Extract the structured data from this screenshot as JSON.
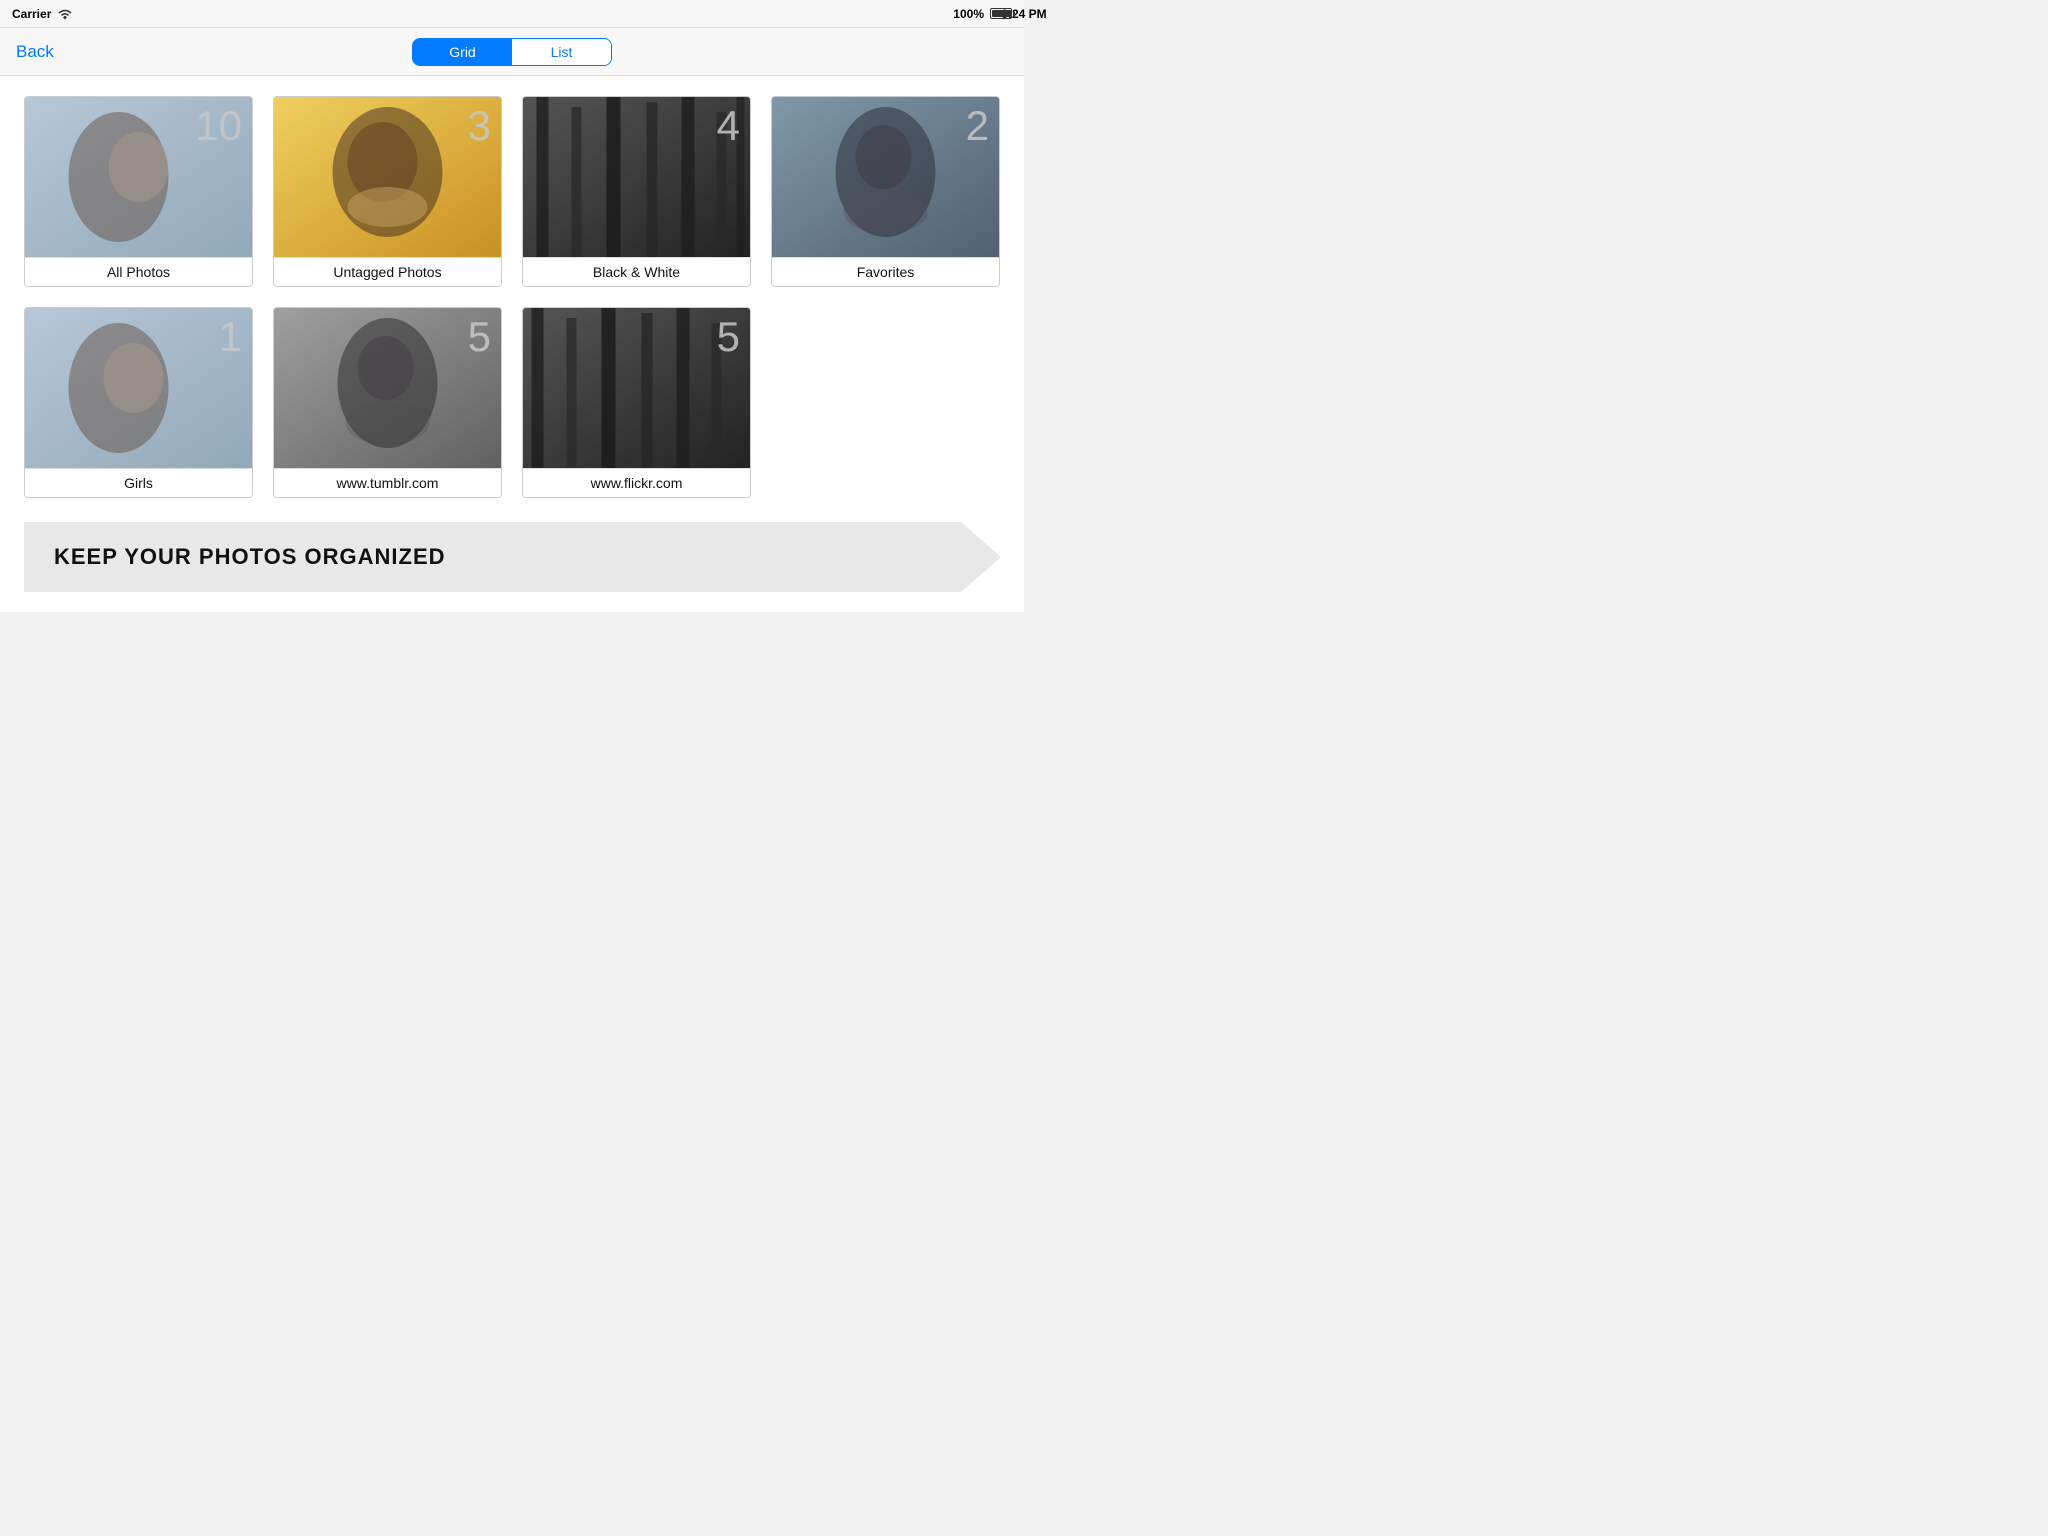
{
  "statusBar": {
    "carrier": "Carrier",
    "time": "9:24 PM",
    "battery": "100%"
  },
  "navBar": {
    "backLabel": "Back",
    "segmented": {
      "grid": "Grid",
      "list": "List",
      "active": "grid"
    }
  },
  "albums": [
    {
      "id": "all-photos",
      "label": "All Photos",
      "count": "10",
      "thumbClass": "thumb-allphotos"
    },
    {
      "id": "untagged-photos",
      "label": "Untagged Photos",
      "count": "3",
      "thumbClass": "thumb-untagged"
    },
    {
      "id": "black-white",
      "label": "Black & White",
      "count": "4",
      "thumbClass": "thumb-blackwhite"
    },
    {
      "id": "favorites",
      "label": "Favorites",
      "count": "2",
      "thumbClass": "thumb-favorites"
    },
    {
      "id": "girls",
      "label": "Girls",
      "count": "1",
      "thumbClass": "thumb-girls"
    },
    {
      "id": "tumblr",
      "label": "www.tumblr.com",
      "count": "5",
      "thumbClass": "thumb-tumblr"
    },
    {
      "id": "flickr",
      "label": "www.flickr.com",
      "count": "5",
      "thumbClass": "thumb-flickr"
    }
  ],
  "banner": {
    "text": "KEEP YOUR PHOTOS ORGANIZED"
  }
}
